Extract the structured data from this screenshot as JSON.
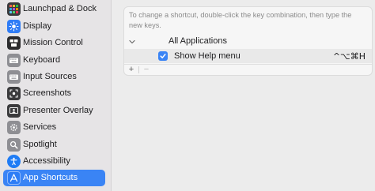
{
  "sidebar": {
    "items": [
      {
        "label": "Launchpad & Dock",
        "icon": "launchpad-icon",
        "color": "#3a3a3c"
      },
      {
        "label": "Display",
        "icon": "display-icon",
        "color": "#2f7cf6"
      },
      {
        "label": "Mission Control",
        "icon": "mission-control-icon",
        "color": "#2b2b2d"
      },
      {
        "label": "Keyboard",
        "icon": "keyboard-icon",
        "color": "#8e8e93"
      },
      {
        "label": "Input Sources",
        "icon": "input-sources-icon",
        "color": "#8e8e93"
      },
      {
        "label": "Screenshots",
        "icon": "screenshots-icon",
        "color": "#3a3a3c"
      },
      {
        "label": "Presenter Overlay",
        "icon": "presenter-overlay-icon",
        "color": "#3a3a3c"
      },
      {
        "label": "Services",
        "icon": "services-icon",
        "color": "#8e8e93"
      },
      {
        "label": "Spotlight",
        "icon": "spotlight-icon",
        "color": "#8e8e93"
      },
      {
        "label": "Accessibility",
        "icon": "accessibility-icon",
        "color": "#1f7cf5"
      },
      {
        "label": "App Shortcuts",
        "icon": "app-shortcuts-icon",
        "color": "#2e7df6",
        "selected": true
      }
    ]
  },
  "main": {
    "hint": "To change a shortcut, double-click the key combination, then type the new keys.",
    "group_label": "All Applications",
    "item_label": "Show Help menu",
    "item_checked": true,
    "item_keys": "^⌥⌘H",
    "add_label": "+",
    "remove_label": "−"
  },
  "colors": {
    "accent": "#3a84f5"
  }
}
